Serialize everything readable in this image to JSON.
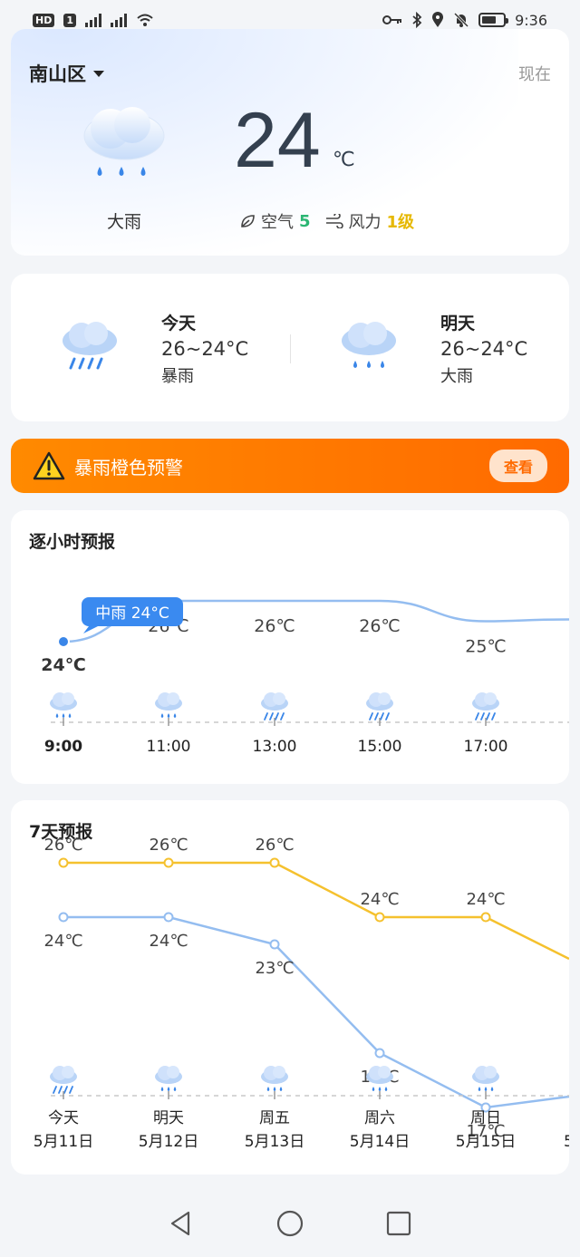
{
  "status_bar": {
    "hd_badge": "HD",
    "sim": "1",
    "time": "9:36"
  },
  "current": {
    "district": "南山区",
    "now_label": "现在",
    "temperature": "24",
    "unit": "℃",
    "condition": "大雨",
    "air_label": "空气",
    "air_value": "5",
    "wind_label": "风力",
    "wind_value": "1级",
    "air_color": "#2bb673",
    "wind_color": "#e6b800"
  },
  "days": {
    "today": {
      "title": "今天",
      "range": "26~24°C",
      "desc": "暴雨",
      "icon": "heavy-rain-icon"
    },
    "tomorrow": {
      "title": "明天",
      "range": "26~24°C",
      "desc": "大雨",
      "icon": "rain-icon"
    }
  },
  "alert": {
    "text": "暴雨橙色预警",
    "button": "查看",
    "color": "#ff7a00"
  },
  "hourly": {
    "title": "逐小时预报",
    "tooltip": "中雨 24°C",
    "hours": [
      {
        "time": "9:00",
        "temp": "24℃",
        "value": 24,
        "icon": "rain-icon",
        "current": true
      },
      {
        "time": "11:00",
        "temp": "26℃",
        "value": 26,
        "icon": "rain-icon"
      },
      {
        "time": "13:00",
        "temp": "26℃",
        "value": 26,
        "icon": "heavy-rain-icon"
      },
      {
        "time": "15:00",
        "temp": "26℃",
        "value": 26,
        "icon": "heavy-rain-icon"
      },
      {
        "time": "17:00",
        "temp": "25℃",
        "value": 25,
        "icon": "heavy-rain-icon"
      }
    ]
  },
  "daily": {
    "title": "7天预报",
    "high_color": "#f5c12e",
    "low_color": "#94bdf0",
    "days": [
      {
        "day": "今天",
        "date": "5月11日",
        "high": "26℃",
        "low": "24℃",
        "high_v": 26,
        "low_v": 24,
        "icon": "heavy-rain-icon"
      },
      {
        "day": "明天",
        "date": "5月12日",
        "high": "26℃",
        "low": "24℃",
        "high_v": 26,
        "low_v": 24,
        "icon": "rain-icon"
      },
      {
        "day": "周五",
        "date": "5月13日",
        "high": "26℃",
        "low": "23℃",
        "high_v": 26,
        "low_v": 23,
        "icon": "rain-icon"
      },
      {
        "day": "周六",
        "date": "5月14日",
        "high": "24℃",
        "low": "19℃",
        "high_v": 24,
        "low_v": 19,
        "icon": "rain-icon"
      },
      {
        "day": "周日",
        "date": "5月15日",
        "high": "24℃",
        "low": "17℃",
        "high_v": 24,
        "low_v": 17,
        "icon": "rain-icon"
      }
    ],
    "overflow_date_stub": "5"
  }
}
